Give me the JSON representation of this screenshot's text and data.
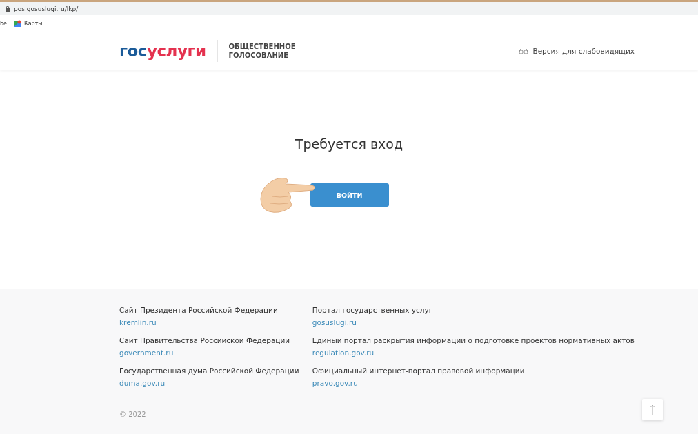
{
  "browser": {
    "url": "pos.gosuslugi.ru/lkp/",
    "bookmarks": [
      {
        "label": "be",
        "kind": "plain"
      },
      {
        "label": "Карты",
        "kind": "maps"
      }
    ]
  },
  "header": {
    "logo": {
      "part_1": "гос",
      "part_2": "услуги"
    },
    "subtitle_line_1": "ОБЩЕСТВЕННОЕ",
    "subtitle_line_2": "ГОЛОСОВАНИЕ",
    "accessibility_link": "Версия для слабовидящих"
  },
  "main": {
    "heading": "Требуется вход",
    "login_button": "ВОЙТИ"
  },
  "footer": {
    "columns": [
      [
        {
          "title": "Сайт Президента Российской Федерации",
          "link": "kremlin.ru"
        },
        {
          "title": "Сайт Правительства Российской Федерации",
          "link": "government.ru"
        },
        {
          "title": "Государственная дума Российской Федерации",
          "link": "duma.gov.ru"
        }
      ],
      [
        {
          "title": "Портал государственных услуг",
          "link": "gosuslugi.ru"
        },
        {
          "title": "Единый портал раскрытия информации о подготовке проектов нормативных актов",
          "link": "regulation.gov.ru"
        },
        {
          "title": "Официальный интернет-портал правовой информации",
          "link": "pravo.gov.ru"
        }
      ]
    ],
    "copyright": "© 2022"
  }
}
